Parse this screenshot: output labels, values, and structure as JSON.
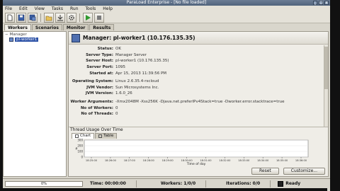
{
  "window": {
    "title": "ParaLoad Enterprise - [No file loaded]"
  },
  "menu": [
    "File",
    "Edit",
    "View",
    "Tasks",
    "Run",
    "Tools",
    "Help"
  ],
  "toolbar": {
    "icons": [
      "new-file-icon",
      "save-icon",
      "save-as-icon",
      "open-icon",
      "import-icon",
      "settings-icon",
      "run-icon",
      "stop-icon"
    ],
    "colors": {
      "run": "#2f9a2f",
      "stop": "#7a7a7a"
    }
  },
  "tabs": [
    "Workers",
    "Scenarios",
    "Monitor",
    "Results"
  ],
  "tree": {
    "root": "Manager",
    "item": "pl-worker1"
  },
  "header": {
    "title": "Manager: pl-worker1 (10.176.135.35)"
  },
  "details": [
    {
      "key": "Status:",
      "value": "OK"
    },
    {
      "key": "Server Type:",
      "value": "Manager Server"
    },
    {
      "key": "Server Host:",
      "value": "pl-worker1 (10.176.135.35)"
    },
    {
      "key": "Server Port:",
      "value": "1095"
    },
    {
      "key": "Started at:",
      "value": "Apr 15, 2013 11:39:56 PM"
    },
    {
      "key": "Operating System:",
      "value": "Linux 2.6.35.4-rscloud"
    },
    {
      "key": "JVM Vendor:",
      "value": "Sun Microsystems Inc."
    },
    {
      "key": "JVM Version:",
      "value": "1.6.0_26"
    },
    {
      "key": "Worker Arguments:",
      "value": "-Xmx2048M -Xss256K -Djava.net.preferIPv4Stack=true -Dworker.error.stacktrace=true"
    },
    {
      "key": "No of Workers:",
      "value": "0"
    },
    {
      "key": "No of Threads:",
      "value": "0"
    }
  ],
  "chart_panel": {
    "title": "Thread Usage Over Time",
    "tabs": [
      "Chart",
      "Table"
    ]
  },
  "chart_data": {
    "type": "line",
    "title": "",
    "xlabel": "Time of day",
    "ylabel": "#",
    "y_ticks": [
      "300",
      "200",
      "100",
      "0"
    ],
    "x_ticks": [
      "18:25:00",
      "18:26:00",
      "18:27:00",
      "18:28:00",
      "18:29:00",
      "18:30:00",
      "18:31:00",
      "18:32:00",
      "18:33:00",
      "18:34:00",
      "18:35:00",
      "18:36:00"
    ],
    "series": [],
    "ylim": [
      0,
      300
    ]
  },
  "buttons": {
    "reset": "Reset",
    "customize": "Customize..."
  },
  "status": {
    "progress": 0,
    "progress_label": "0%",
    "time": "Time: 00:00:00",
    "workers": "Workers: 1/0/0",
    "iterations": "Iterations: 0/0",
    "ready": "Ready"
  }
}
